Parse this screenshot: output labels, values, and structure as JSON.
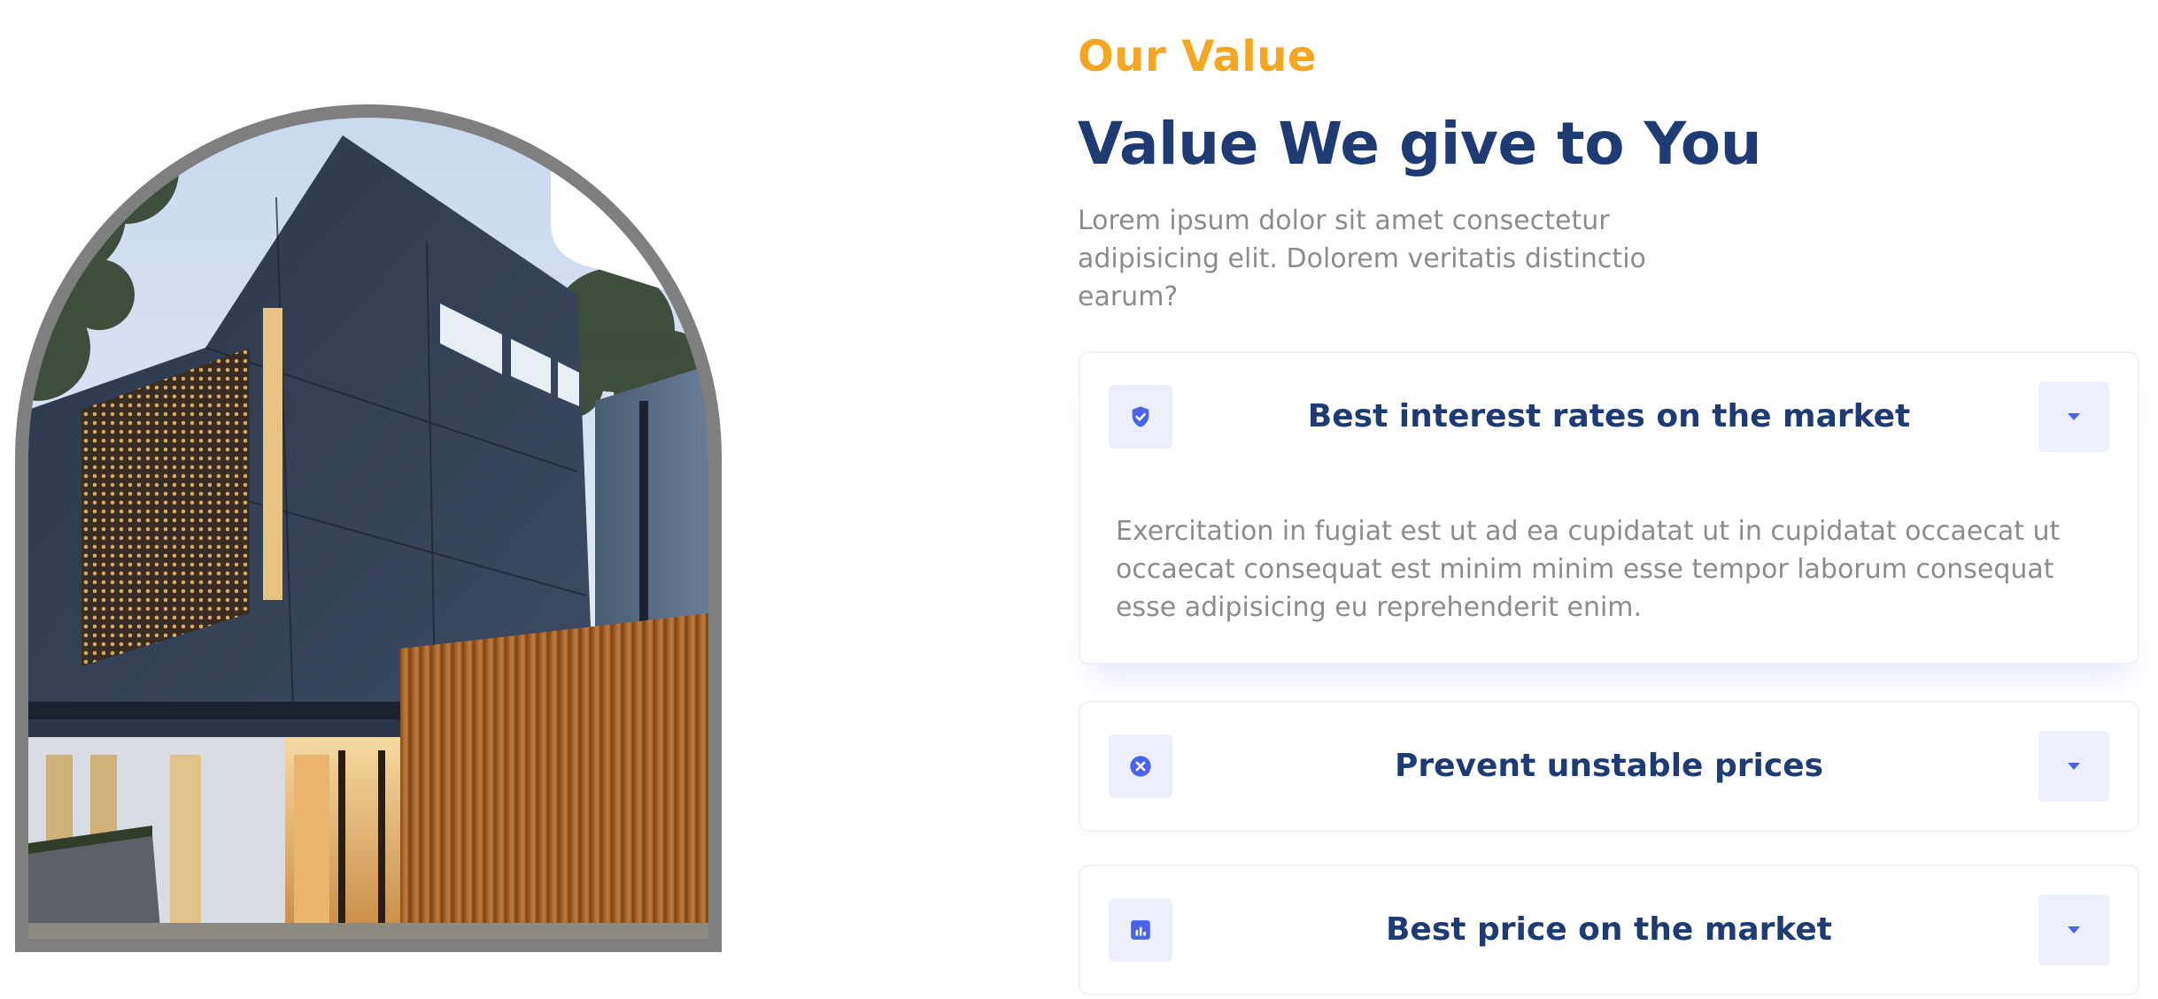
{
  "section": {
    "eyebrow": "Our Value",
    "title": "Value We give to You",
    "lead": "Lorem ipsum dolor sit amet consectetur adipisicing elit. Dolorem veritatis distinctio earum?"
  },
  "accordion": {
    "items": [
      {
        "title": "Best interest rates on the market",
        "icon": "shield-check-icon",
        "expanded": true,
        "body": "Exercitation in fugiat est ut ad ea cupidatat ut in cupidatat occaecat ut occaecat consequat est minim minim esse tempor laborum consequat esse adipisicing eu reprehenderit enim."
      },
      {
        "title": "Prevent unstable prices",
        "icon": "close-circle-icon",
        "expanded": false
      },
      {
        "title": "Best price on the market",
        "icon": "chart-box-icon",
        "expanded": false
      }
    ]
  },
  "colors": {
    "accent": "#f5a623",
    "heading": "#1f3b73",
    "text_muted": "#8c8c8c",
    "icon_blue": "#4a63e7",
    "icon_bg": "#eeeffc"
  }
}
